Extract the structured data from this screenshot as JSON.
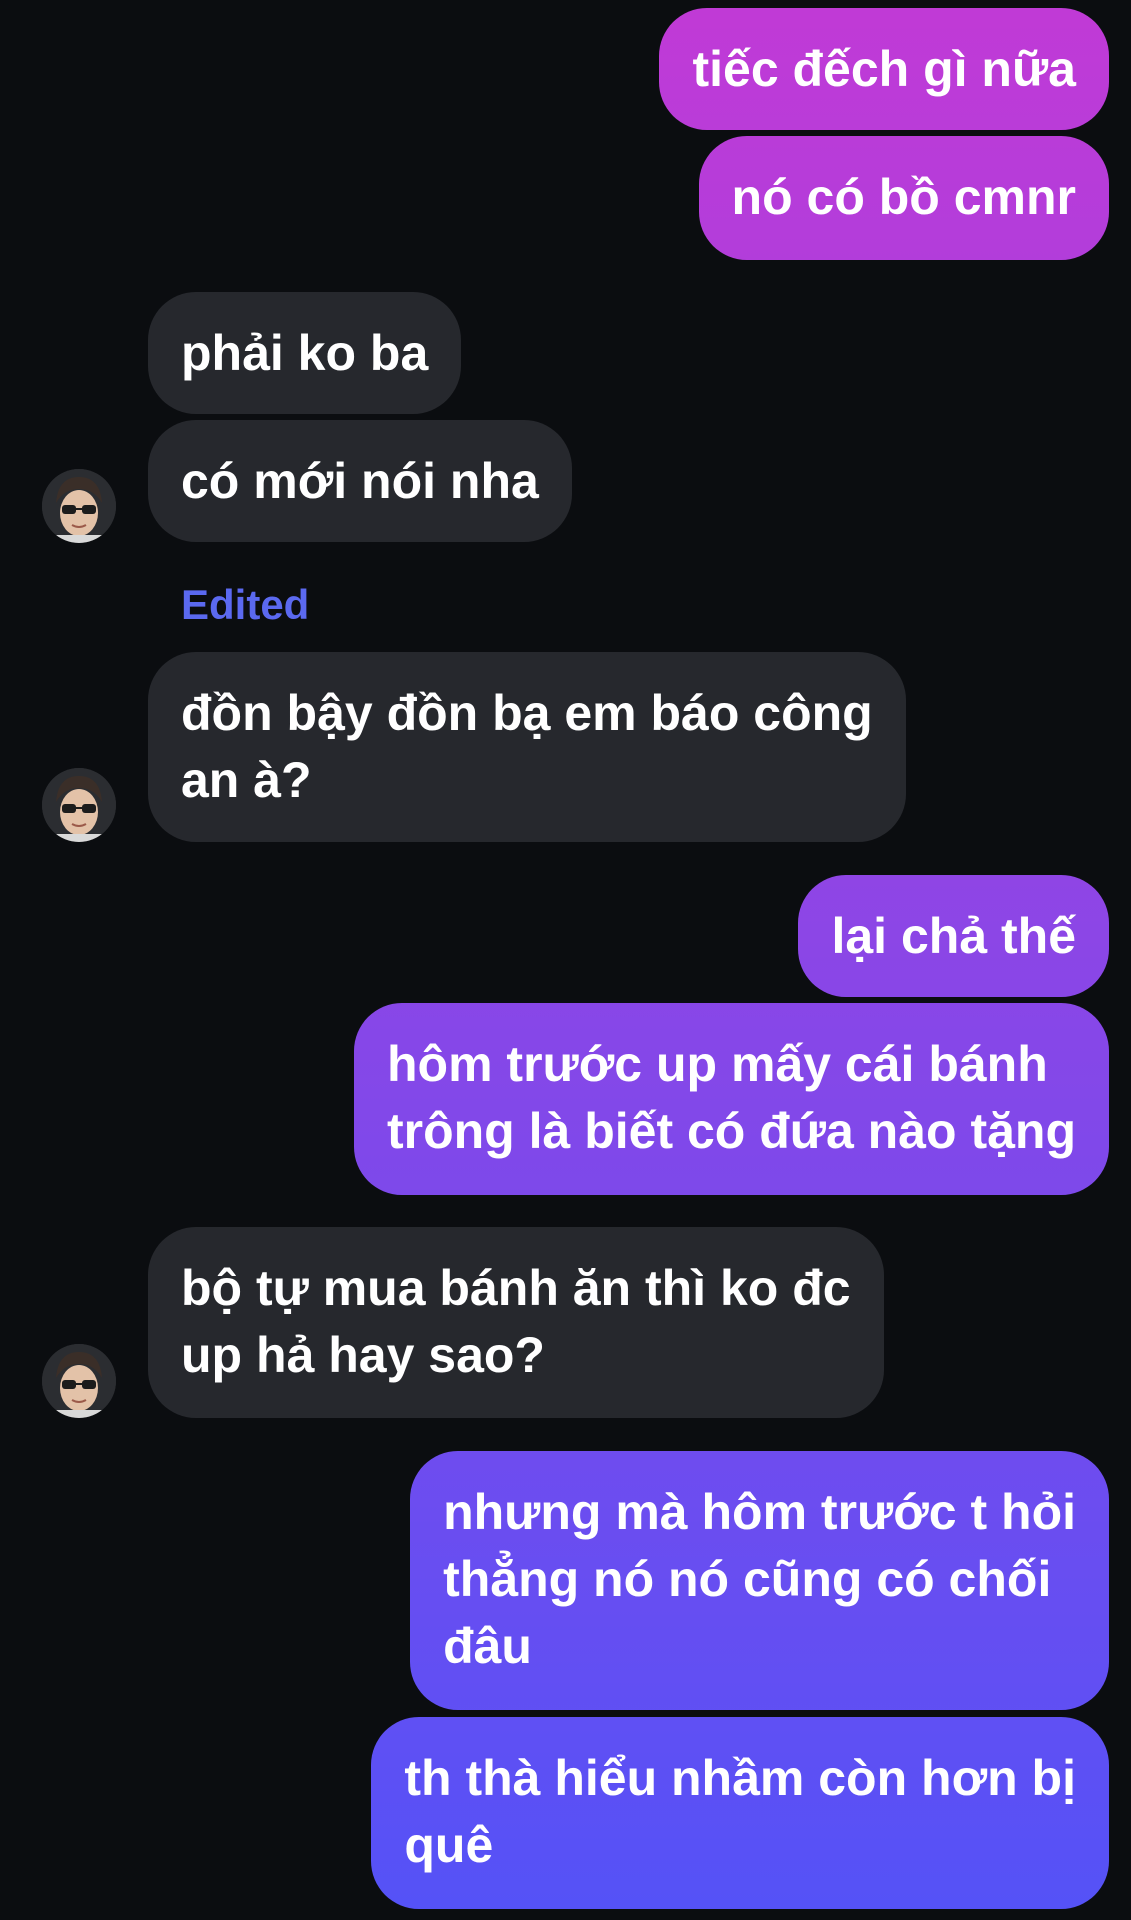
{
  "messages": [
    {
      "from": "me",
      "lines": [
        "tiếc đếch gì nữa"
      ]
    },
    {
      "from": "me",
      "lines": [
        "nó có bồ cmnr"
      ]
    },
    {
      "from": "them",
      "lines": [
        "phải ko ba"
      ]
    },
    {
      "from": "them",
      "lines": [
        "có mới nói nha"
      ]
    },
    {
      "from": "them",
      "edited_label": "Edited",
      "lines": [
        "đồn bậy đồn bạ em báo công",
        "an à?"
      ]
    },
    {
      "from": "me",
      "lines": [
        "lại chả thế"
      ]
    },
    {
      "from": "me",
      "lines": [
        "hôm trước up mấy cái bánh",
        "trông là biết có đứa nào tặng"
      ]
    },
    {
      "from": "them",
      "lines": [
        "bộ tự mua bánh ăn thì ko đc",
        "up hả hay sao?"
      ]
    },
    {
      "from": "me",
      "lines": [
        "nhưng mà hôm trước t hỏi",
        "thẳng nó nó cũng có chối",
        "đâu"
      ]
    },
    {
      "from": "me",
      "lines": [
        "th thà hiểu nhầm còn hơn bị",
        "quê"
      ]
    }
  ],
  "colors": {
    "background": "#0b0d10",
    "incoming_bubble": "#26282d",
    "outgoing_gradient_top": "#c13ad6",
    "outgoing_gradient_bottom": "#5452f7",
    "edited_label": "#5b69f0",
    "text": "#ffffff"
  },
  "icons": {
    "avatar": "contact-avatar-photo"
  }
}
